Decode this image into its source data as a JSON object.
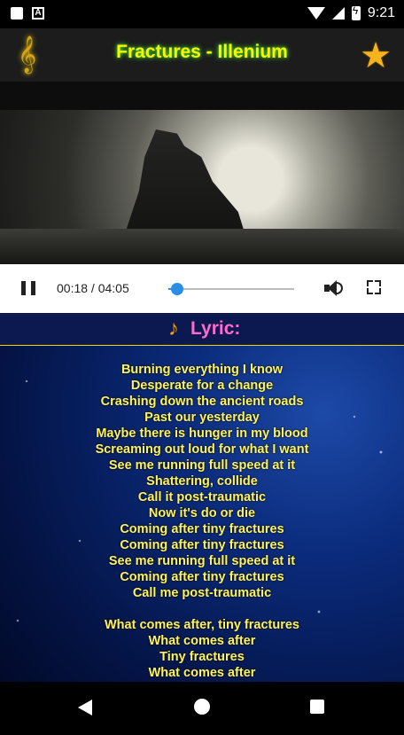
{
  "status_bar": {
    "time": "9:21"
  },
  "header": {
    "title": "Fractures - Illenium"
  },
  "player": {
    "time_display": "00:18 / 04:05",
    "progress": 0.07
  },
  "lyrics": {
    "label": "Lyric:",
    "lines": [
      "Burning everything I know",
      "Desperate for a change",
      "Crashing down the ancient roads",
      "Past our yesterday",
      "Maybe there is hunger in my blood",
      "Screaming out loud for what I want",
      "See me running full speed at it",
      "Shattering, collide",
      "Call it post-traumatic",
      "Now it's do or die",
      "Coming after tiny fractures",
      "Coming after tiny fractures",
      "See me running full speed at it",
      "Coming after tiny fractures",
      "Call me post-traumatic",
      "",
      "What comes after, tiny fractures",
      "What comes after",
      "Tiny fractures",
      "What comes after"
    ]
  },
  "colors": {
    "title": "#fdf200",
    "lyric_label": "#ff6bd0",
    "lyric_text": "#fff35a",
    "progress_accent": "#2a8ee6"
  }
}
